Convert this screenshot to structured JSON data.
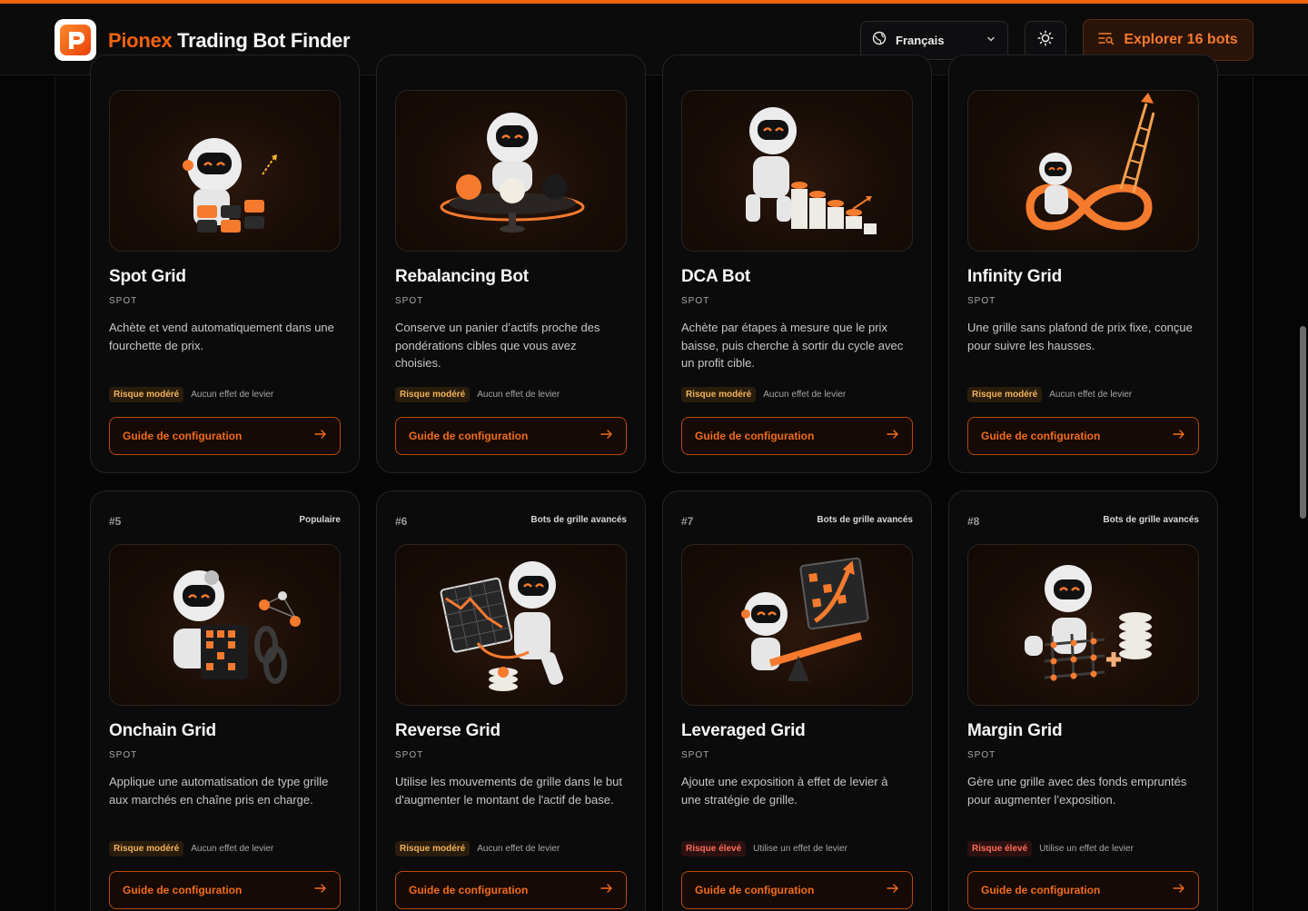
{
  "header": {
    "brand_accent": "Pionex",
    "brand_rest": "Trading Bot Finder",
    "language": "Français",
    "explore_label": "Explorer 16 bots"
  },
  "colors": {
    "accent": "#f0620e",
    "background": "#050505",
    "risk_moderate": "#f2b35c",
    "risk_high": "#ff6d5a"
  },
  "icons": [
    "logo-icon",
    "globe-icon",
    "chevron-down-icon",
    "sun-icon",
    "filter-search-icon",
    "arrow-right-icon"
  ],
  "cards": [
    {
      "num": "",
      "category": "",
      "title": "Spot Grid",
      "type": "SPOT",
      "desc": "Achète et vend automatiquement dans une fourchette de prix.",
      "risk": "Risque modéré",
      "risk_level": "moderate",
      "leverage": "Aucun effet de levier",
      "guide": "Guide de configuration"
    },
    {
      "num": "",
      "category": "",
      "title": "Rebalancing Bot",
      "type": "SPOT",
      "desc": "Conserve un panier d’actifs proche des pondérations cibles que vous avez choisies.",
      "risk": "Risque modéré",
      "risk_level": "moderate",
      "leverage": "Aucun effet de levier",
      "guide": "Guide de configuration"
    },
    {
      "num": "",
      "category": "",
      "title": "DCA Bot",
      "type": "SPOT",
      "desc": "Achète par étapes à mesure que le prix baisse, puis cherche à sortir du cycle avec un profit cible.",
      "risk": "Risque modéré",
      "risk_level": "moderate",
      "leverage": "Aucun effet de levier",
      "guide": "Guide de configuration"
    },
    {
      "num": "",
      "category": "",
      "title": "Infinity Grid",
      "type": "SPOT",
      "desc": "Une grille sans plafond de prix fixe, conçue pour suivre les hausses.",
      "risk": "Risque modéré",
      "risk_level": "moderate",
      "leverage": "Aucun effet de levier",
      "guide": "Guide de configuration"
    },
    {
      "num": "#5",
      "category": "Populaire",
      "title": "Onchain Grid",
      "type": "SPOT",
      "desc": "Applique une automatisation de type grille aux marchés en chaîne pris en charge.",
      "risk": "Risque modéré",
      "risk_level": "moderate",
      "leverage": "Aucun effet de levier",
      "guide": "Guide de configuration"
    },
    {
      "num": "#6",
      "category": "Bots de grille avancés",
      "title": "Reverse Grid",
      "type": "SPOT",
      "desc": "Utilise les mouvements de grille dans le but d'augmenter le montant de l'actif de base.",
      "risk": "Risque modéré",
      "risk_level": "moderate",
      "leverage": "Aucun effet de levier",
      "guide": "Guide de configuration"
    },
    {
      "num": "#7",
      "category": "Bots de grille avancés",
      "title": "Leveraged Grid",
      "type": "SPOT",
      "desc": "Ajoute une exposition à effet de levier à une stratégie de grille.",
      "risk": "Risque élevé",
      "risk_level": "high",
      "leverage": "Utilise un effet de levier",
      "guide": "Guide de configuration"
    },
    {
      "num": "#8",
      "category": "Bots de grille avancés",
      "title": "Margin Grid",
      "type": "SPOT",
      "desc": "Gère une grille avec des fonds empruntés pour augmenter l’exposition.",
      "risk": "Risque élevé",
      "risk_level": "high",
      "leverage": "Utilise un effet de levier",
      "guide": "Guide de configuration"
    }
  ]
}
